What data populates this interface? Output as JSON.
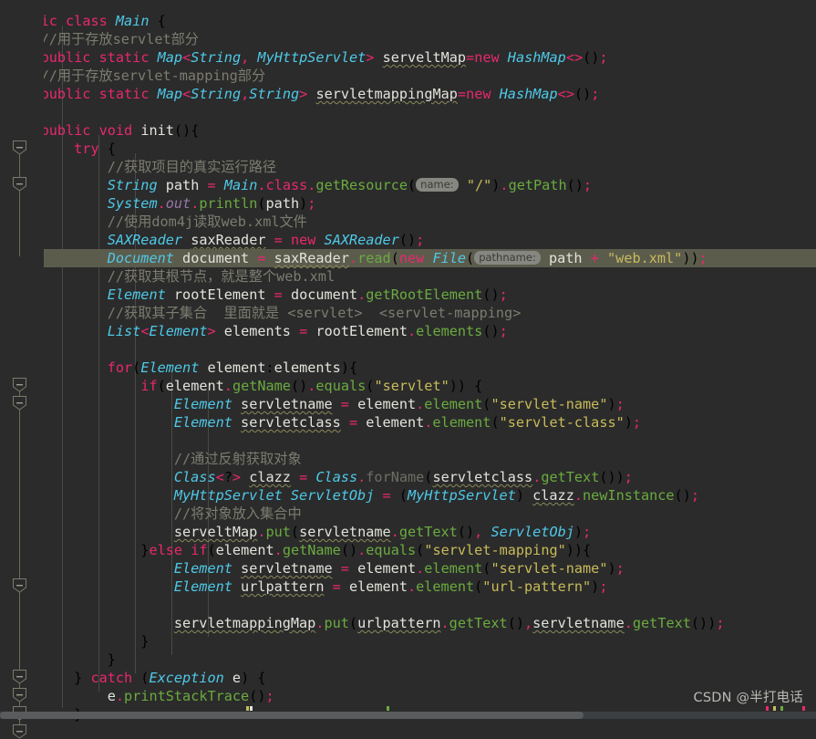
{
  "editor": {
    "language": "java",
    "theme": "darcula",
    "background_color": "#2b2b2b",
    "current_line_color": "#5c5c4d",
    "selection_color": "#6a6a55",
    "font_size_px": 15
  },
  "watermark": {
    "text": "CSDN @半打电话"
  },
  "hints": {
    "name": "name:",
    "pathname": "pathname:"
  },
  "gutter": {
    "fold_marker_icon": "fold-collapse-icon",
    "fold_marker_rows": [
      7,
      9,
      20,
      21,
      31,
      36,
      37,
      38,
      39
    ]
  },
  "code": {
    "lines": [
      {
        "row": 0,
        "text": "public class Main {"
      },
      {
        "row": 1,
        "text": "    //用于存放servlet部分"
      },
      {
        "row": 2,
        "text": "    public static Map<String, MyHttpServlet> serveltMap=new HashMap<>();"
      },
      {
        "row": 3,
        "text": "    //用于存放servlet-mapping部分"
      },
      {
        "row": 4,
        "text": "    public static Map<String,String> servletmappingMap=new HashMap<>();"
      },
      {
        "row": 5,
        "text": ""
      },
      {
        "row": 6,
        "text": "    public void init(){"
      },
      {
        "row": 7,
        "text": "        try {"
      },
      {
        "row": 8,
        "text": "            //获取项目的真实运行路径"
      },
      {
        "row": 9,
        "text": "            String path = Main.class.getResource( name: \"/\").getPath();"
      },
      {
        "row": 10,
        "text": "            System.out.println(path);"
      },
      {
        "row": 11,
        "text": "            //使用dom4j读取web.xml文件"
      },
      {
        "row": 12,
        "text": "            SAXReader saxReader = new SAXReader();"
      },
      {
        "row": 13,
        "text": "            Document document = saxReader.read(new File( pathname: path + \"web.xml\"));"
      },
      {
        "row": 14,
        "text": "            //获取其根节点，就是整个web.xml"
      },
      {
        "row": 15,
        "text": "            Element rootElement = document.getRootElement();"
      },
      {
        "row": 16,
        "text": "            //获取其子集合  里面就是 <servlet>  <servlet-mapping>"
      },
      {
        "row": 17,
        "text": "            List<Element> elements = rootElement.elements();"
      },
      {
        "row": 18,
        "text": ""
      },
      {
        "row": 19,
        "text": "            for(Element element:elements){"
      },
      {
        "row": 20,
        "text": "                if(element.getName().equals(\"servlet\")) {"
      },
      {
        "row": 21,
        "text": "                    Element servletname = element.element(\"servlet-name\");"
      },
      {
        "row": 22,
        "text": "                    Element servletclass = element.element(\"servlet-class\");"
      },
      {
        "row": 23,
        "text": ""
      },
      {
        "row": 24,
        "text": "                    //通过反射获取对象"
      },
      {
        "row": 25,
        "text": "                    Class<?> clazz = Class.forName(servletclass.getText());"
      },
      {
        "row": 26,
        "text": "                    MyHttpServlet ServletObj = (MyHttpServlet) clazz.newInstance();"
      },
      {
        "row": 27,
        "text": "                    //将对象放入集合中"
      },
      {
        "row": 28,
        "text": "                    serveltMap.put(servletname.getText(), ServletObj);"
      },
      {
        "row": 29,
        "text": "                }else if(element.getName().equals(\"servlet-mapping\")){"
      },
      {
        "row": 30,
        "text": "                    Element servletname = element.element(\"servlet-name\");"
      },
      {
        "row": 31,
        "text": "                    Element urlpattern = element.element(\"url-pattern\");"
      },
      {
        "row": 32,
        "text": ""
      },
      {
        "row": 33,
        "text": "                    servletmappingMap.put(urlpattern.getText(),servletname.getText());"
      },
      {
        "row": 34,
        "text": "                }"
      },
      {
        "row": 35,
        "text": "            }"
      },
      {
        "row": 36,
        "text": "        } catch (Exception e) {"
      },
      {
        "row": 37,
        "text": "            e.printStackTrace();"
      },
      {
        "row": 38,
        "text": "        }"
      }
    ],
    "current_line_row": 13,
    "selected_text": "rootElement.elements",
    "deprecated_token": "forName",
    "misspelled_tokens": [
      "serveltMap",
      "servletmappingMap",
      "servletname",
      "servletclass",
      "urlpattern",
      "saxReader",
      "clazz"
    ]
  },
  "status_bar": {
    "scroll_position": "horizontal"
  }
}
